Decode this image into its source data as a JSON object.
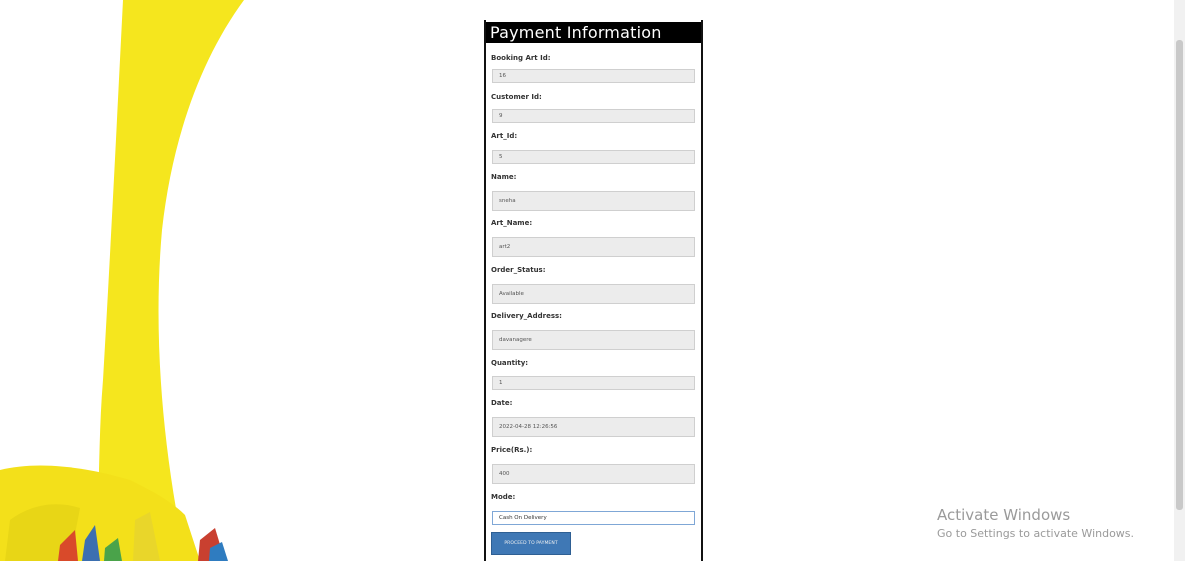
{
  "payment": {
    "title": "Payment Information",
    "fields": [
      {
        "label": "Booking Art Id:",
        "value": "16"
      },
      {
        "label": "Customer Id:",
        "value": "9"
      },
      {
        "label": "Art_Id:",
        "value": "5"
      },
      {
        "label": "Name:",
        "value": "sneha"
      },
      {
        "label": "Art_Name:",
        "value": "art2"
      },
      {
        "label": "Order_Status:",
        "value": "Available"
      },
      {
        "label": "Delivery_Address:",
        "value": "davanagere"
      },
      {
        "label": "Quantity:",
        "value": "1"
      },
      {
        "label": "Date:",
        "value": "2022-04-28 12:26:56"
      },
      {
        "label": "Price(Rs.):",
        "value": "400"
      },
      {
        "label": "Mode:",
        "value": "Cash On Delivery"
      }
    ],
    "submit_label": "PROCEED TO PAYMENT"
  },
  "watermark": {
    "line1": "Activate Windows",
    "line2": "Go to Settings to activate Windows."
  },
  "colors": {
    "art_yellow": "#f5e61e",
    "button_blue": "#3f78b5",
    "title_bg": "#000000"
  }
}
